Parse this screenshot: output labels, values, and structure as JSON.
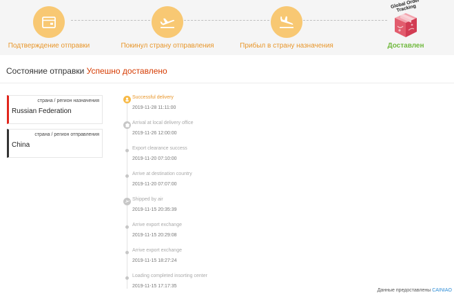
{
  "progress": {
    "steps": [
      {
        "label": "Подтверждение отправки",
        "icon": "package-confirm-icon",
        "state": "complete"
      },
      {
        "label": "Покинул страну отправления",
        "icon": "plane-departure-icon",
        "state": "complete"
      },
      {
        "label": "Прибыл в страну назначения",
        "icon": "plane-arrival-icon",
        "state": "complete"
      },
      {
        "label": "Доставлен",
        "icon": "global-order-tracking-box-icon",
        "state": "current"
      }
    ],
    "final_caption_line1": "Global Order",
    "final_caption_line2": "Tracking",
    "colors": {
      "step_circle": "#f8c873",
      "step_label": "#e8962a",
      "delivered_label": "#71b93f"
    }
  },
  "status": {
    "prefix": "Состояние отправки",
    "value": "Успешно доставлено",
    "value_color": "#d53a00"
  },
  "destination": {
    "label": "страна / регион назначения",
    "value": "Russian Federation",
    "accent": "#e1251b"
  },
  "origin": {
    "label": "страна / регион отправления",
    "value": "China",
    "accent": "#333333"
  },
  "timeline": [
    {
      "desc": "Successful delivery",
      "time": "2019-11-28 11:11:00",
      "marker": "delivered-icon",
      "active": true
    },
    {
      "desc": "Arrival at local delivery office",
      "time": "2019-11-26 12:00:00",
      "marker": "delivery-office-icon",
      "active": false
    },
    {
      "desc": "Export clearance success",
      "time": "2019-11-20 07:10:00",
      "marker": "dot",
      "active": false
    },
    {
      "desc": "Arrive at destination country",
      "time": "2019-11-20 07:07:00",
      "marker": "dot",
      "active": false
    },
    {
      "desc": "Shipped by air",
      "time": "2019-11-15 20:35:39",
      "marker": "airplane-icon",
      "active": false
    },
    {
      "desc": "Arrive export exchange",
      "time": "2019-11-15 20:29:08",
      "marker": "dot",
      "active": false
    },
    {
      "desc": "Arrive export exchange",
      "time": "2019-11-15 18:27:24",
      "marker": "dot",
      "active": false
    },
    {
      "desc": "Loading completed insorting center",
      "time": "2019-11-15 17:17:35",
      "marker": "dot",
      "active": false
    }
  ],
  "footer": {
    "provided_by": "Данные предоставлены",
    "provider": "CAINIAO",
    "provider_color": "#2a8bd6"
  }
}
